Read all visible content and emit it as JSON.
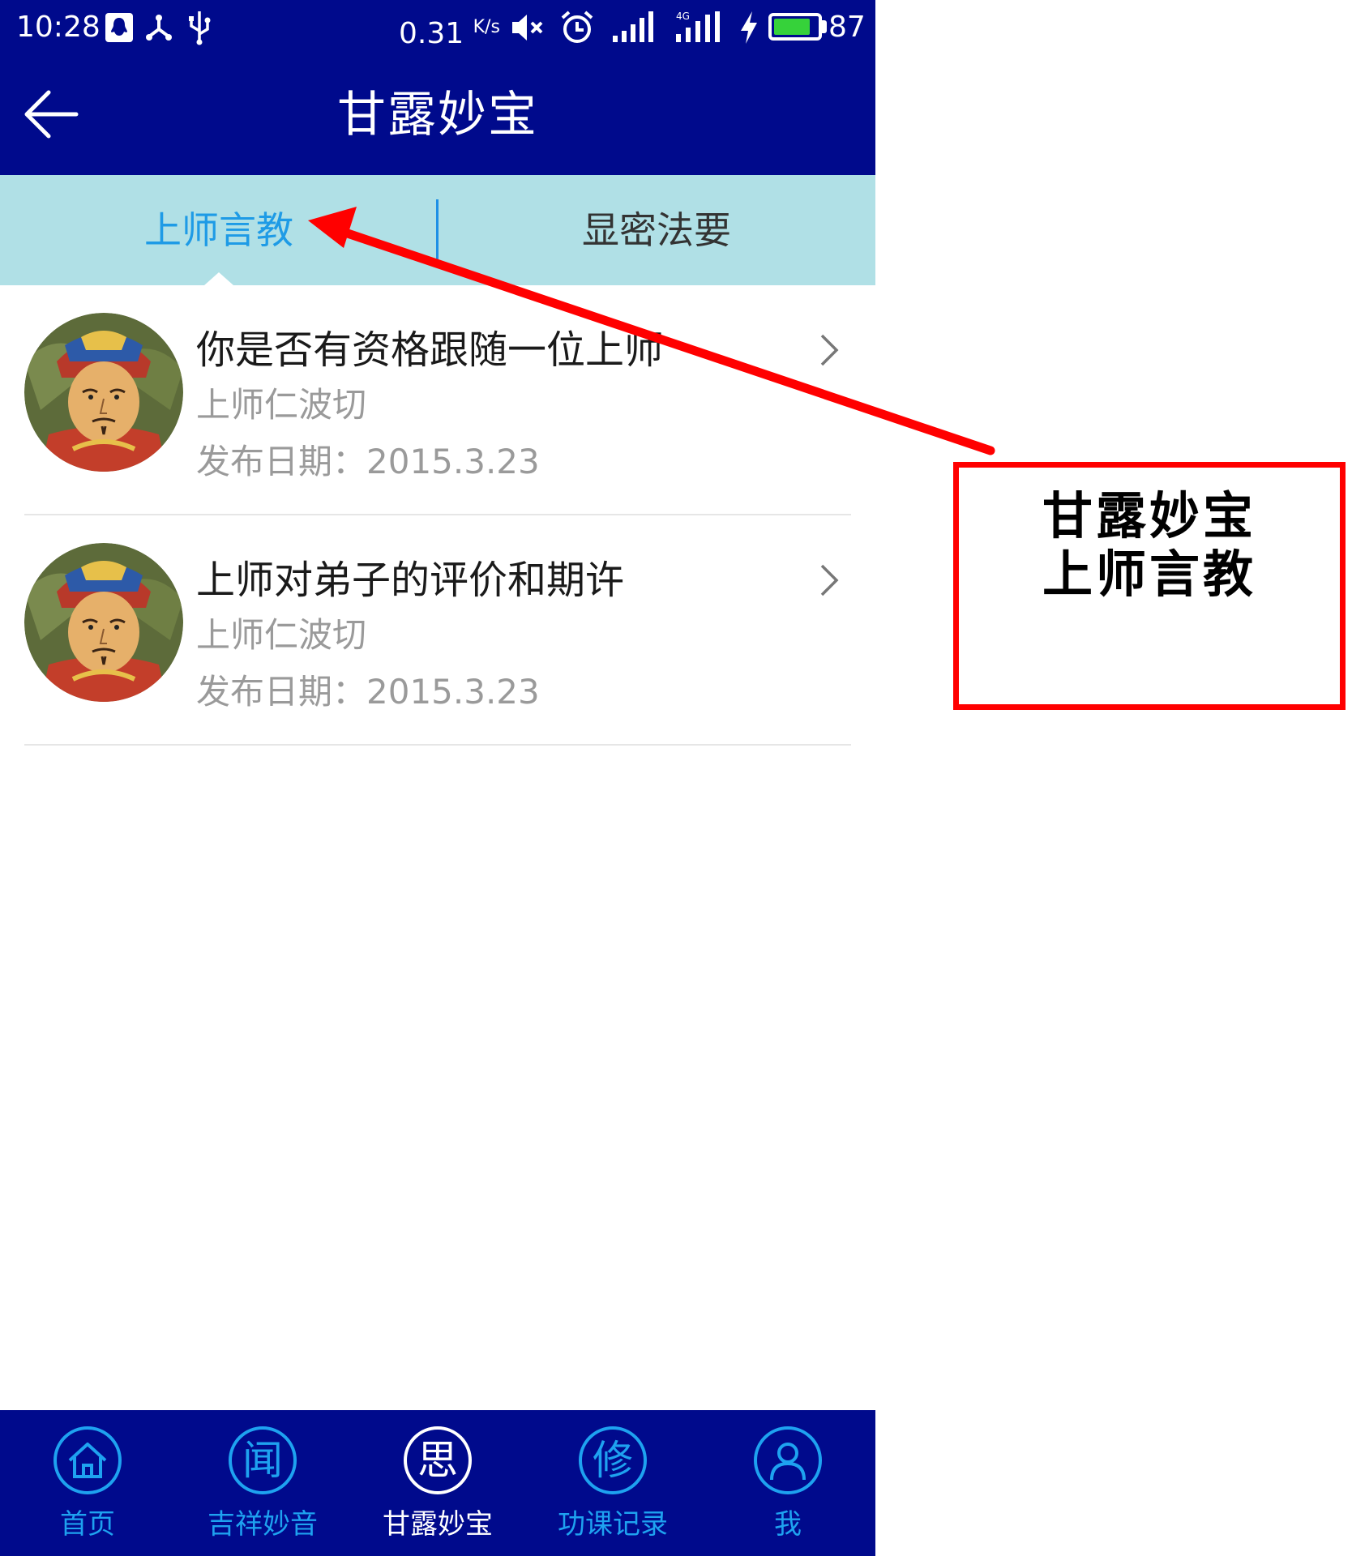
{
  "status_bar": {
    "time": "10:28",
    "net_speed": "0.31",
    "net_speed_unit": "K/s",
    "battery_level": "87",
    "battery_fraction": 0.87,
    "battery_color": "#36d23a",
    "left_icons": [
      "qq-icon",
      "share-icon",
      "usb-icon"
    ],
    "right_icons": [
      "mute-icon",
      "alarm-icon",
      "signal-icon",
      "signal-4g-icon",
      "charging-icon",
      "battery-icon"
    ]
  },
  "header": {
    "title": "甘露妙宝",
    "back_icon": "arrow-left-icon",
    "background": "#000a8c"
  },
  "tabs": {
    "active_index": 0,
    "items": [
      {
        "label": "上师言教"
      },
      {
        "label": "显密法要"
      }
    ],
    "background": "#b0e0e6",
    "active_color": "#1e9be6"
  },
  "list": {
    "items": [
      {
        "title": "你是否有资格跟随一位上师",
        "author": "上师仁波切",
        "date": "发布日期：2015.3.23",
        "avatar": "guru-avatar"
      },
      {
        "title": "上师对弟子的评价和期许",
        "author": "上师仁波切",
        "date": "发布日期：2015.3.23",
        "avatar": "guru-avatar"
      }
    ]
  },
  "bottom_nav": {
    "active_index": 2,
    "items": [
      {
        "label": "首页",
        "glyph": "",
        "icon": "home-icon"
      },
      {
        "label": "吉祥妙音",
        "glyph": "闻",
        "icon": "listen-icon"
      },
      {
        "label": "甘露妙宝",
        "glyph": "思",
        "icon": "contemplate-icon"
      },
      {
        "label": "功课记录",
        "glyph": "修",
        "icon": "practice-icon"
      },
      {
        "label": "我",
        "glyph": "",
        "icon": "user-icon"
      }
    ],
    "accent_color": "#1ea2f0"
  },
  "annotation": {
    "line1": "甘露妙宝",
    "line2": "上师言教",
    "color": "#ff0000"
  }
}
